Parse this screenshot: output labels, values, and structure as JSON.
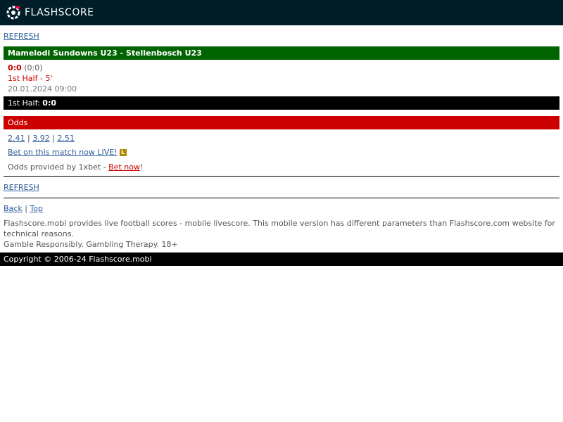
{
  "header": {
    "logo_text": "FLASHSCORE",
    "logo_icon": "flashscore-logo-icon",
    "colors": {
      "background": "#001e28",
      "accent": "#ff0046"
    }
  },
  "refresh_top": "REFRESH",
  "match": {
    "title": "Mamelodi Sundowns U23 - Stellenbosch U23",
    "score": "0:0",
    "score_sub": "(0:0)",
    "period": "1st Half - 5'",
    "datetime": "20.01.2024 09:00",
    "half_label": "1st Half:",
    "half_score": "0:0"
  },
  "odds": {
    "heading": "Odds",
    "values": [
      "2.41",
      "3.92",
      "2.51"
    ],
    "separator": "|",
    "bet_live_link": "Bet on this match now LIVE!",
    "live_badge": "L",
    "provided_text": "Odds provided by 1xbet - ",
    "bet_now_link": "Bet now",
    "provided_suffix": "!"
  },
  "refresh_bottom": "REFRESH",
  "nav": {
    "back": "Back",
    "separator": "|",
    "top": "Top"
  },
  "about": {
    "line1": "Flashscore.mobi provides live football scores - mobile livescore. This mobile version has different parameters than Flashscore.com website for technical reasons.",
    "line2": "Gamble Responsibly. Gambling Therapy. 18+"
  },
  "footer": "Copyright © 2006-24 Flashscore.mobi",
  "colors": {
    "match_bar": "#006400",
    "odds_bar": "#cc0000",
    "score_red": "#c80000",
    "link_blue": "#2f5d9b"
  }
}
